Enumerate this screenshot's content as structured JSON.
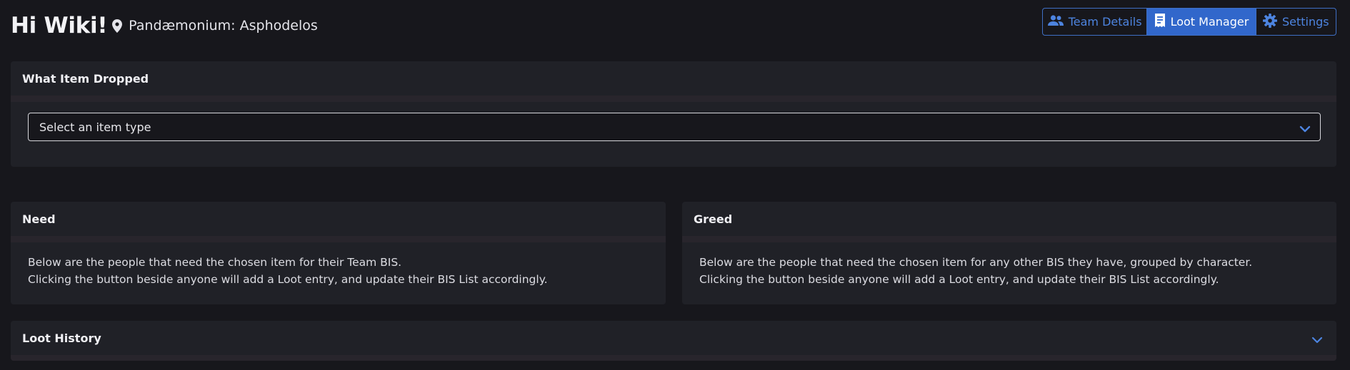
{
  "header": {
    "greeting": "Hi Wiki!",
    "location_icon": "map-pin-icon",
    "team_name": "Pandæmonium: Asphodelos"
  },
  "nav": {
    "items": [
      {
        "label": "Team Details",
        "icon": "users-icon",
        "active": false
      },
      {
        "label": "Loot Manager",
        "icon": "receipt-icon",
        "active": true
      },
      {
        "label": "Settings",
        "icon": "gear-icon",
        "active": false
      }
    ]
  },
  "item_dropped": {
    "title": "What Item Dropped",
    "select_value": "Select an item type",
    "select_icon": "chevron-down-icon"
  },
  "need": {
    "title": "Need",
    "line1": "Below are the people that need the chosen item for their Team BIS.",
    "line2": "Clicking the button beside anyone will add a Loot entry, and update their BIS List accordingly."
  },
  "greed": {
    "title": "Greed",
    "line1": "Below are the people that need the chosen item for any other BIS they have, grouped by character.",
    "line2": "Clicking the button beside anyone will add a Loot entry, and update their BIS List accordingly."
  },
  "loot_history": {
    "title": "Loot History",
    "expand_icon": "chevron-down-icon"
  },
  "colors": {
    "background": "#17171c",
    "card": "#202127",
    "accent": "#3167cb",
    "accent_text": "#4d84e0"
  }
}
